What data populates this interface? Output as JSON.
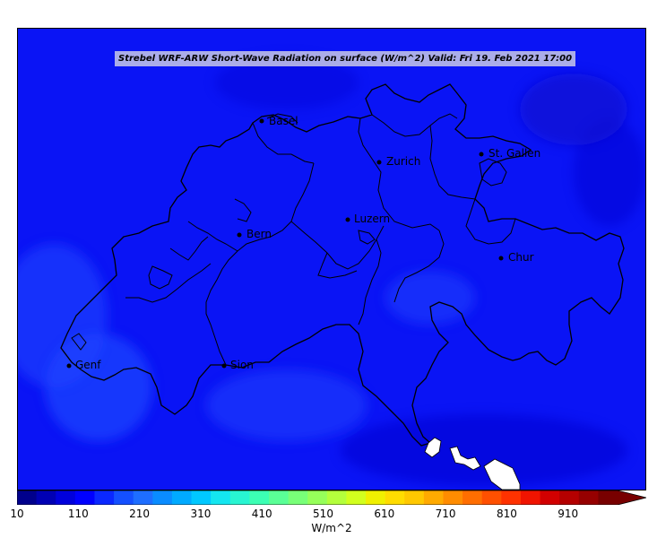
{
  "title": "Strebel WRF-ARW Short-Wave Radiation on surface (W/m^2)    Valid: Fri 19. Feb 2021 17:00",
  "colors": {
    "background_field": "#0a14f5",
    "field_light": "#1e46ff",
    "field_dark": "#0a0ad2",
    "border": "#000000"
  },
  "cities": [
    {
      "name": "Basel"
    },
    {
      "name": "Zurich"
    },
    {
      "name": "St. Gallen"
    },
    {
      "name": "Luzern"
    },
    {
      "name": "Bern"
    },
    {
      "name": "Chur"
    },
    {
      "name": "Genf"
    },
    {
      "name": "Sion"
    }
  ],
  "colorbar": {
    "unit": "W/m^2",
    "ticks": [
      "10",
      "110",
      "210",
      "310",
      "410",
      "510",
      "610",
      "710",
      "810",
      "910"
    ],
    "colors": [
      "#00008c",
      "#0000b4",
      "#0000dc",
      "#0000ff",
      "#0a28ff",
      "#1450ff",
      "#1e6eff",
      "#0a8cff",
      "#00aaff",
      "#00c8ff",
      "#14e6f0",
      "#28f5d2",
      "#3cffb4",
      "#5aff96",
      "#78ff78",
      "#96ff5a",
      "#b4ff3c",
      "#d2ff1e",
      "#f0f000",
      "#ffdc00",
      "#ffc800",
      "#ffaa00",
      "#ff8c00",
      "#ff6e00",
      "#ff5000",
      "#ff3200",
      "#f01400",
      "#d20000",
      "#b40000",
      "#960000",
      "#780000"
    ]
  }
}
